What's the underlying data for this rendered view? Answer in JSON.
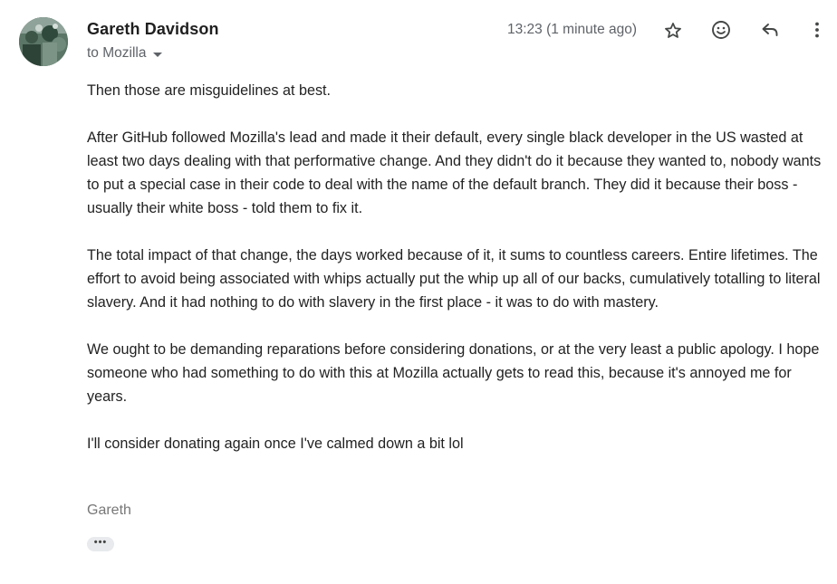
{
  "message": {
    "sender_name": "Gareth Davidson",
    "recipient_label": "to Mozilla",
    "timestamp": "13:23 (1 minute ago)",
    "icons": {
      "star": "star-icon",
      "emoji": "emoji-reaction-icon",
      "reply": "reply-icon",
      "more": "more-vert-icon",
      "caret": "chevron-down-icon"
    },
    "paragraphs": [
      "Then those are misguidelines at best.",
      "After GitHub followed Mozilla's lead and made it their default, every single black developer in the US wasted at least two days dealing with that performative change. And they didn't do it because they wanted to, nobody wants to put a special case in their code to deal with the name of the default branch. They did it because their boss - usually their white boss - told them to fix it.",
      "The total impact of that change, the days worked because of it, it sums to countless careers. Entire lifetimes. The effort to avoid being associated with whips actually put the whip up all of our backs, cumulatively totalling to literal slavery. And it had nothing to do with slavery in the first place - it was to do with mastery.",
      "We ought to be demanding reparations before considering donations, or at the very least a public apology. I hope someone who had something to do with this at Mozilla actually gets to read this, because it's annoyed me for years.",
      "I'll consider donating again once I've calmed down a bit lol"
    ],
    "signature": "Gareth",
    "trimmed_content_label": "•••"
  },
  "colors": {
    "text": "#222222",
    "secondary_text": "#5f6368",
    "signature_text": "#777777",
    "icon": "#444746",
    "trimmed_button_bg": "#e8eaed"
  }
}
